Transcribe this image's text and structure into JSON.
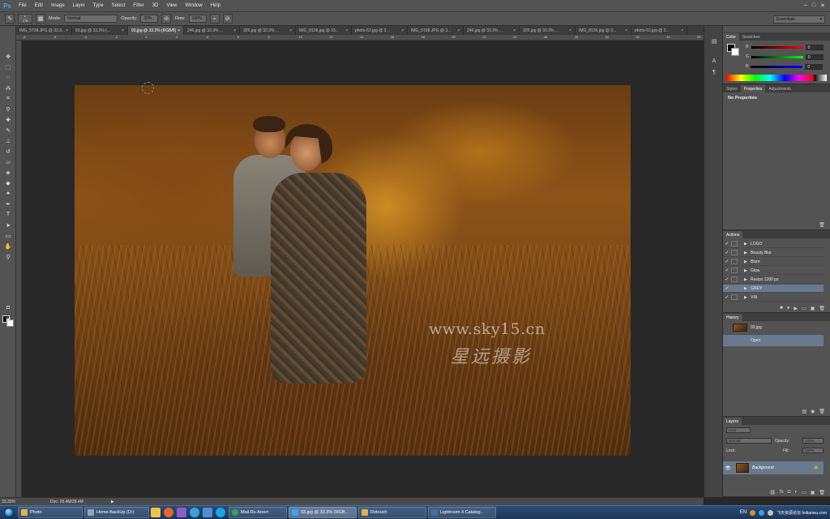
{
  "app": {
    "logo": "Ps",
    "menu": [
      "File",
      "Edit",
      "Image",
      "Layer",
      "Type",
      "Select",
      "Filter",
      "3D",
      "View",
      "Window",
      "Help"
    ],
    "window_controls": [
      "–",
      "□",
      "✕"
    ]
  },
  "options_bar": {
    "brush_size": "175",
    "mode_label": "Mode:",
    "mode_value": "Normal",
    "opacity_label": "Opacity:",
    "opacity_value": "30%",
    "flow_label": "Flow:",
    "flow_value": "100%",
    "workspace": "Essentials"
  },
  "tabs": [
    {
      "label": "IMG_5738.JPG @ 33.3...",
      "active": false
    },
    {
      "label": "93.jpg @ 33.3% (...",
      "active": false
    },
    {
      "label": "93.jpg @ 33.3% (RGB/8)",
      "active": true
    },
    {
      "label": "246.jpg @ 33.3% ...",
      "active": false
    },
    {
      "label": "325.jpg @ 33.3% ...",
      "active": false
    },
    {
      "label": "IMG_8136.jpg @ 33...",
      "active": false
    },
    {
      "label": "photo-63.jpg @ 3...",
      "active": false
    },
    {
      "label": "IMG_5738.JPG @ 3...",
      "active": false
    },
    {
      "label": "246.jpg @ 33.3% ...",
      "active": false
    },
    {
      "label": "325.jpg @ 33.3% ...",
      "active": false
    },
    {
      "label": "IMG_8136.jpg @ 3...",
      "active": false
    },
    {
      "label": "photo-63.jpg @ 3...",
      "active": false
    }
  ],
  "ruler_marks": [
    "-8",
    "-6",
    "-4",
    "-2",
    "0",
    "2",
    "4",
    "6",
    "8",
    "10",
    "12",
    "14",
    "16",
    "18",
    "20",
    "22",
    "24",
    "26",
    "28",
    "30",
    "32",
    "34",
    "36"
  ],
  "canvas": {
    "watermark_url": "www.sky15.cn",
    "watermark_cn": "星远摄影"
  },
  "status": {
    "zoom": "33.33%",
    "doc": "Doc: 28.4M/28.4M"
  },
  "color_panel": {
    "tabs": [
      "Color",
      "Swatches"
    ],
    "r": "0",
    "g": "0",
    "b": "0"
  },
  "props_panel": {
    "tabs": [
      "Styles",
      "Properties",
      "Adjustments"
    ],
    "empty_label": "No Properties"
  },
  "actions_panel": {
    "tab": "Actions",
    "items": [
      {
        "name": "LOGO",
        "selected": false
      },
      {
        "name": "Beauty Blur",
        "selected": false
      },
      {
        "name": "Blure",
        "selected": false
      },
      {
        "name": "Glow",
        "selected": false
      },
      {
        "name": "Resize 1280 px",
        "selected": false
      },
      {
        "name": "GREY",
        "selected": true
      },
      {
        "name": "VIN",
        "selected": false
      }
    ]
  },
  "history_panel": {
    "tab": "History",
    "snapshot": "93.jpg",
    "items": [
      {
        "name": "Open",
        "selected": true
      }
    ]
  },
  "layers_panel": {
    "tab": "Layers",
    "kind": "Kind",
    "blend": "Normal",
    "opacity_label": "Opacity:",
    "opacity": "100%",
    "lock_label": "Lock:",
    "fill_label": "Fill:",
    "fill": "100%",
    "layer_name": "Background"
  },
  "taskbar": {
    "tasks": [
      {
        "label": "Photo",
        "active": false,
        "color": "#e3b341"
      },
      {
        "label": "Home BackUp (D:)",
        "active": false,
        "color": "#9aa6b2"
      },
      {
        "label": "Mail.Ru Агент",
        "active": false,
        "color": "#2fa84f"
      },
      {
        "label": "93.jpg @ 33.3% (RGB...",
        "active": true,
        "color": "#31a8ff"
      },
      {
        "label": "Retouch",
        "active": false,
        "color": "#e3b341"
      },
      {
        "label": "Lightroom 4 Catalog...",
        "active": false,
        "color": "#4a6d9a"
      }
    ],
    "lang": "EN",
    "tray_text": "飞天资源论坛 feitianwu.com"
  }
}
